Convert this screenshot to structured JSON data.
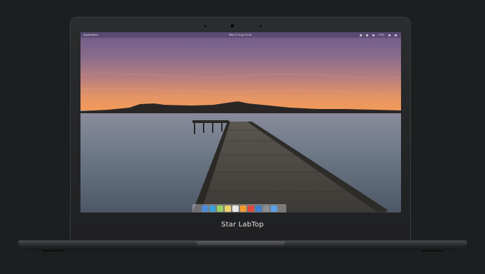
{
  "device": {
    "brand_label": "Star LabTop"
  },
  "topbar": {
    "apps_label": "Applications",
    "clock": "Wed 27 Aug 19:16",
    "indicators": [
      "notifications-icon",
      "volume-icon",
      "network-icon",
      "battery-icon",
      "power-icon"
    ],
    "battery_text": "97%"
  },
  "dock": {
    "apps": [
      {
        "name": "files-app",
        "color": "#4a8ad8"
      },
      {
        "name": "web-browser-app",
        "color": "#3aa0d8"
      },
      {
        "name": "mail-app",
        "color": "#9bd063"
      },
      {
        "name": "notes-app",
        "color": "#f1d26a"
      },
      {
        "name": "calendar-app",
        "color": "#e8e8e8"
      },
      {
        "name": "music-app",
        "color": "#f29a2e"
      },
      {
        "name": "videos-app",
        "color": "#e0463e"
      },
      {
        "name": "photos-app",
        "color": "#3b7fd0"
      },
      {
        "name": "settings-app",
        "color": "#8a8d92"
      },
      {
        "name": "app-center-app",
        "color": "#5aa0e8"
      }
    ]
  }
}
